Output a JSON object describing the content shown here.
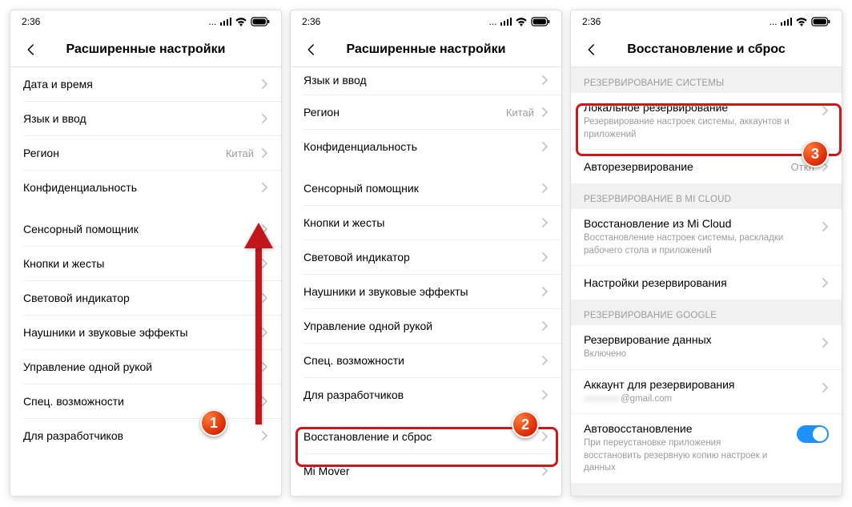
{
  "statusbar": {
    "time": "2:36",
    "dots": "..."
  },
  "headers": {
    "advanced": "Расширенные настройки",
    "backup": "Восстановление и сброс"
  },
  "badges": {
    "one": "1",
    "two": "2",
    "three": "3"
  },
  "screen1": {
    "datetime": "Дата и время",
    "language": "Язык и ввод",
    "region": "Регион",
    "region_value": "Китай",
    "privacy": "Конфиденциальность",
    "touch_assist": "Сенсорный помощник",
    "buttons_gestures": "Кнопки и жесты",
    "led": "Световой индикатор",
    "headphones": "Наушники и звуковые эффекты",
    "onehand": "Управление одной рукой",
    "accessibility": "Спец. возможности",
    "developer": "Для разработчиков"
  },
  "screen2": {
    "language": "Язык и ввод",
    "region": "Регион",
    "region_value": "Китай",
    "privacy": "Конфиденциальность",
    "touch_assist": "Сенсорный помощник",
    "buttons_gestures": "Кнопки и жесты",
    "led": "Световой индикатор",
    "headphones": "Наушники и звуковые эффекты",
    "onehand": "Управление одной рукой",
    "accessibility": "Спец. возможности",
    "developer": "Для разработчиков",
    "backup_reset": "Восстановление и сброс",
    "mi_mover": "Mi Mover"
  },
  "screen3": {
    "sec_system": "РЕЗЕРВИРОВАНИЕ СИСТЕМЫ",
    "local_backup": "Локальное резервирование",
    "local_backup_sub": "Резервирование настроек системы, аккаунтов и приложений",
    "auto_backup": "Авторезервирование",
    "auto_backup_value": "Откл",
    "sec_micloud": "РЕЗЕРВИРОВАНИЕ В MI CLOUD",
    "restore_micloud": "Восстановление из Mi Cloud",
    "restore_micloud_sub": "Восстановление настроек системы, раскладки рабочего стола и приложений",
    "backup_settings": "Настройки резервирования",
    "sec_google": "РЕЗЕРВИРОВАНИЕ GOOGLE",
    "data_backup": "Резервирование данных",
    "data_backup_sub": "Включено",
    "backup_account": "Аккаунт для резервирования",
    "backup_account_sub": "@gmail.com",
    "auto_restore": "Автовосстановление",
    "auto_restore_sub": "При переустановке приложения восстановить резервную копию настроек и данных"
  }
}
